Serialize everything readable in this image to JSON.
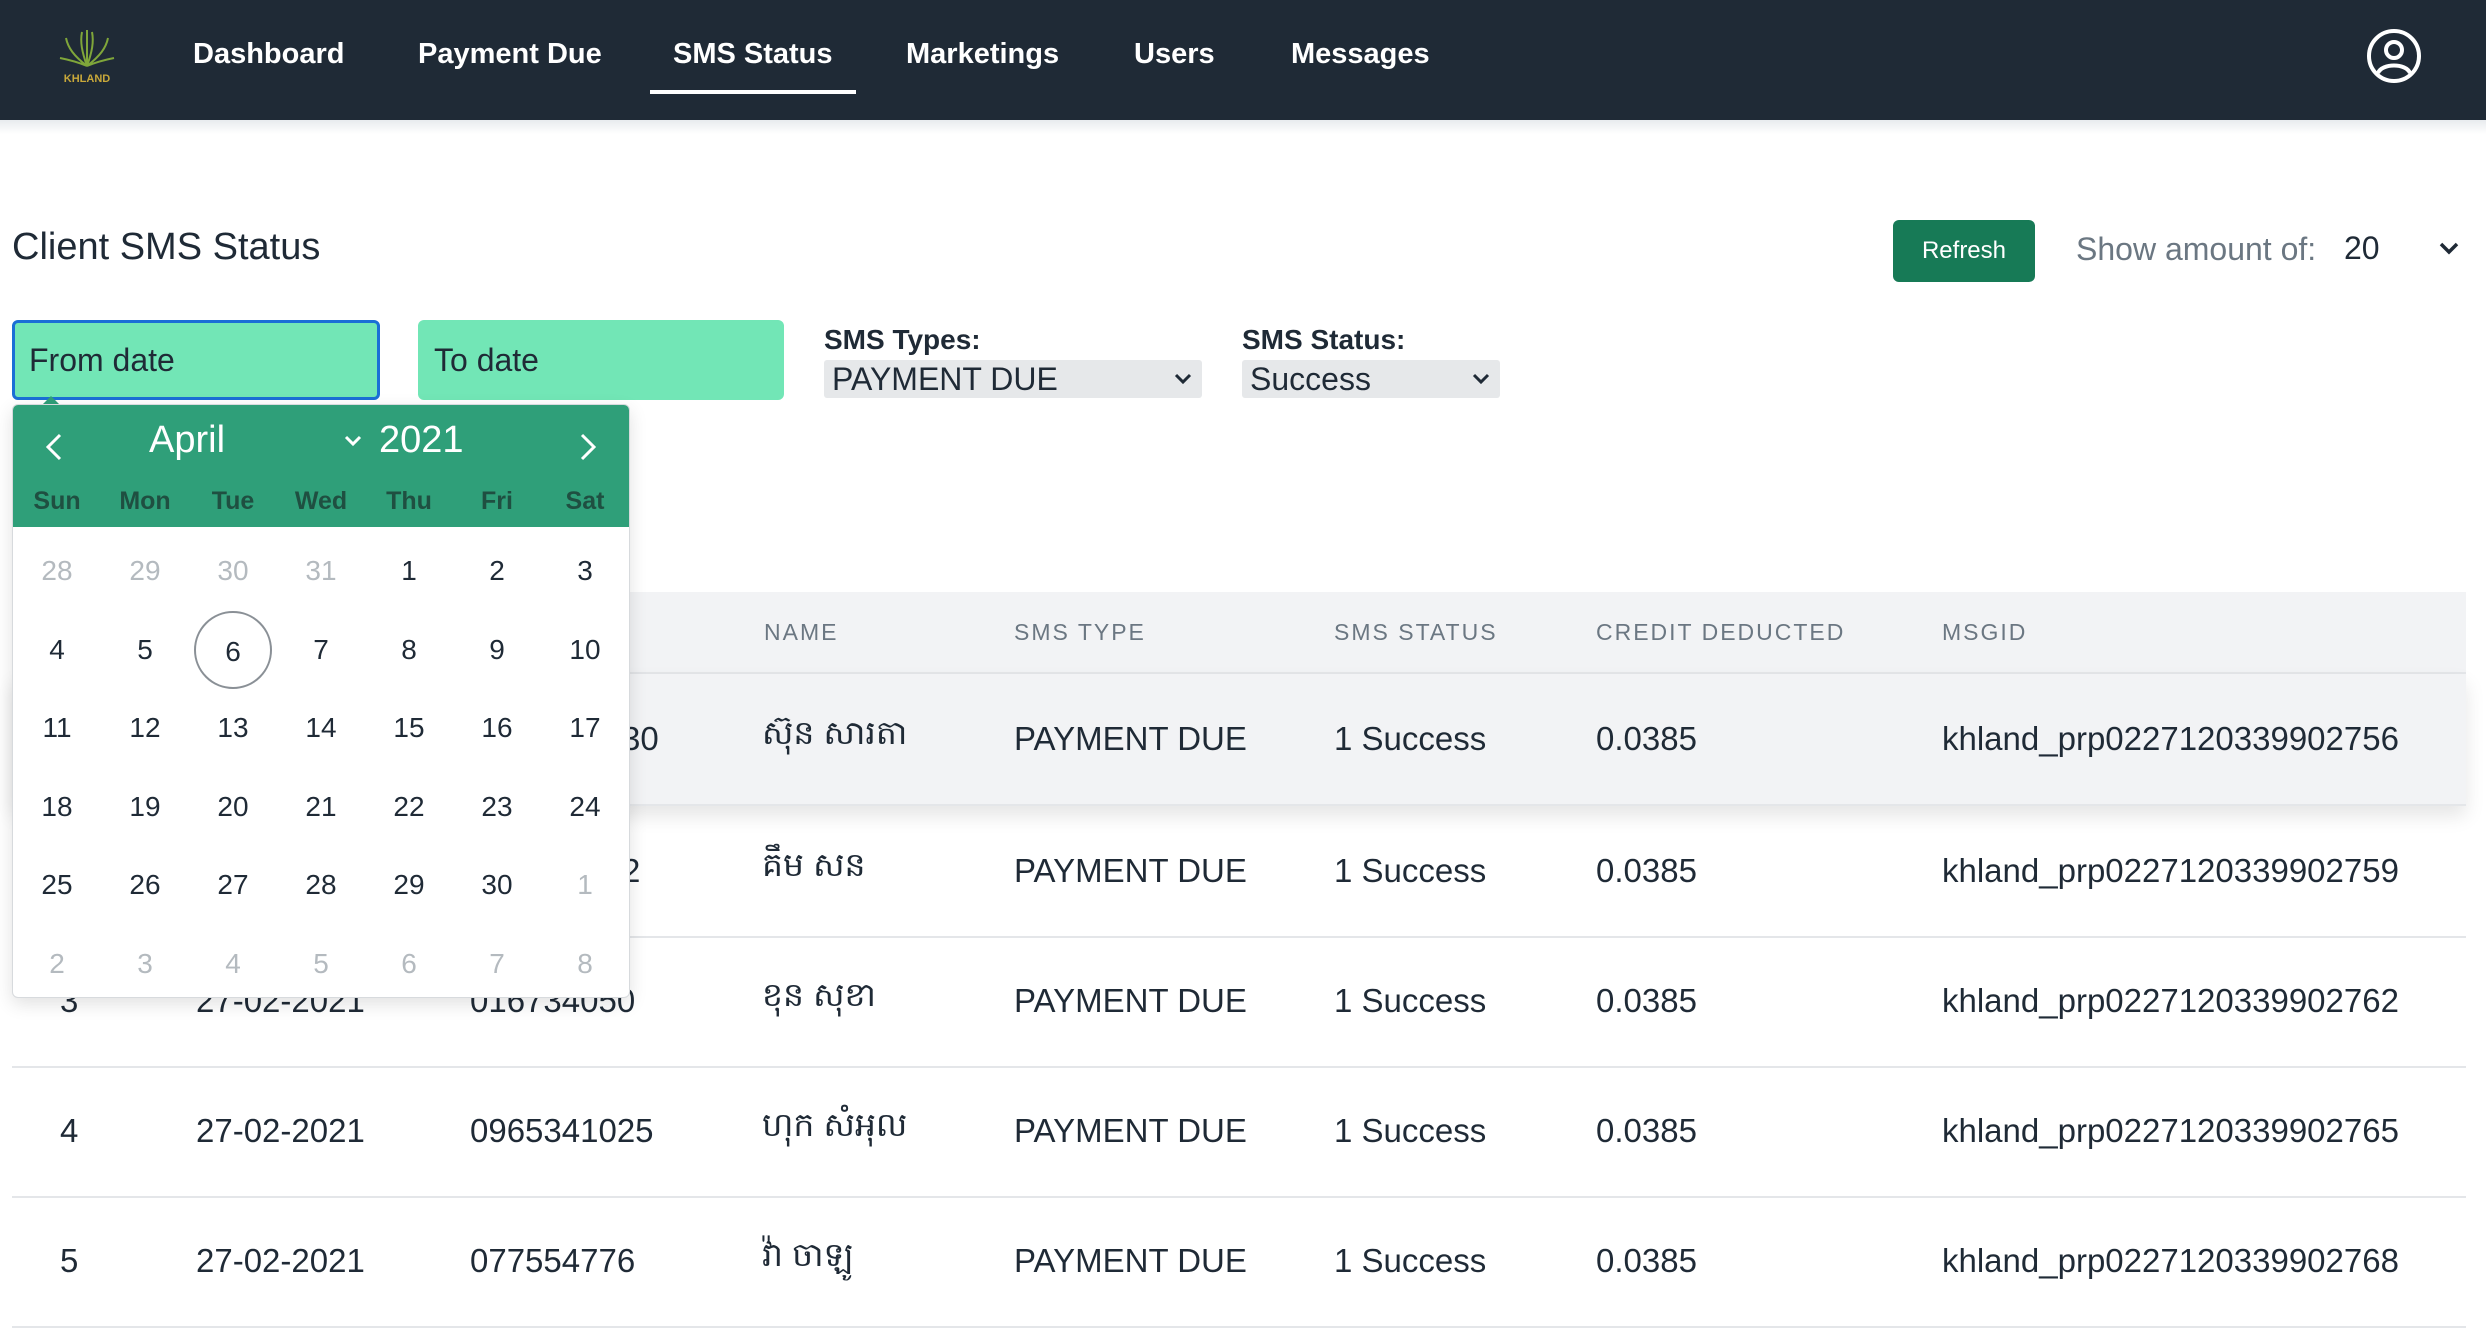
{
  "nav": {
    "logo_text": "KHLAND",
    "items": [
      {
        "label": "Dashboard"
      },
      {
        "label": "Payment Due"
      },
      {
        "label": "SMS Status"
      },
      {
        "label": "Marketings"
      },
      {
        "label": "Users"
      },
      {
        "label": "Messages"
      }
    ],
    "active": "SMS Status",
    "account_icon": "user-circle-icon"
  },
  "page": {
    "title": "Client SMS Status",
    "refresh_label": "Refresh",
    "show_amount_label": "Show amount of:",
    "show_amount_value": "20"
  },
  "filters": {
    "from_date_placeholder": "From date",
    "to_date_placeholder": "To date",
    "sms_types_label": "SMS Types:",
    "sms_types_value": "PAYMENT DUE",
    "sms_status_label": "SMS Status:",
    "sms_status_value": "Success"
  },
  "calendar": {
    "month": "April",
    "year": "2021",
    "weekdays": [
      "Sun",
      "Mon",
      "Tue",
      "Wed",
      "Thu",
      "Fri",
      "Sat"
    ],
    "weeks": [
      [
        {
          "d": "28",
          "m": true
        },
        {
          "d": "29",
          "m": true
        },
        {
          "d": "30",
          "m": true
        },
        {
          "d": "31",
          "m": true
        },
        {
          "d": "1"
        },
        {
          "d": "2"
        },
        {
          "d": "3"
        }
      ],
      [
        {
          "d": "4"
        },
        {
          "d": "5"
        },
        {
          "d": "6",
          "today": true
        },
        {
          "d": "7"
        },
        {
          "d": "8"
        },
        {
          "d": "9"
        },
        {
          "d": "10"
        }
      ],
      [
        {
          "d": "11"
        },
        {
          "d": "12"
        },
        {
          "d": "13"
        },
        {
          "d": "14"
        },
        {
          "d": "15"
        },
        {
          "d": "16"
        },
        {
          "d": "17"
        }
      ],
      [
        {
          "d": "18"
        },
        {
          "d": "19"
        },
        {
          "d": "20"
        },
        {
          "d": "21"
        },
        {
          "d": "22"
        },
        {
          "d": "23"
        },
        {
          "d": "24"
        }
      ],
      [
        {
          "d": "25"
        },
        {
          "d": "26"
        },
        {
          "d": "27"
        },
        {
          "d": "28"
        },
        {
          "d": "29"
        },
        {
          "d": "30"
        },
        {
          "d": "1",
          "m": true
        }
      ],
      [
        {
          "d": "2",
          "m": true
        },
        {
          "d": "3",
          "m": true
        },
        {
          "d": "4",
          "m": true
        },
        {
          "d": "5",
          "m": true
        },
        {
          "d": "6",
          "m": true
        },
        {
          "d": "7",
          "m": true
        },
        {
          "d": "8",
          "m": true
        }
      ]
    ]
  },
  "table": {
    "headers": {
      "name": "NAME",
      "sms_type": "SMS TYPE",
      "sms_status": "SMS STATUS",
      "credit": "CREDIT DEDUCTED",
      "msgid": "MSGID"
    },
    "rows": [
      {
        "no": "",
        "date": "",
        "phone": "30",
        "name": "ស៊ុន សារតា",
        "sms_type": "PAYMENT DUE",
        "sms_status": "1 Success",
        "credit": "0.0385",
        "msgid": "khland_prp0227120339902756"
      },
      {
        "no": "",
        "date": "",
        "phone": "2",
        "name": "គឹម សន",
        "sms_type": "PAYMENT DUE",
        "sms_status": "1 Success",
        "credit": "0.0385",
        "msgid": "khland_prp0227120339902759"
      },
      {
        "no": "3",
        "date": "27-02-2021",
        "phone": "016734050",
        "name": "ខុន សុខា",
        "sms_type": "PAYMENT DUE",
        "sms_status": "1 Success",
        "credit": "0.0385",
        "msgid": "khland_prp0227120339902762"
      },
      {
        "no": "4",
        "date": "27-02-2021",
        "phone": "0965341025",
        "name": "ហុក សំអុល",
        "sms_type": "PAYMENT DUE",
        "sms_status": "1 Success",
        "credit": "0.0385",
        "msgid": "khland_prp0227120339902765"
      },
      {
        "no": "5",
        "date": "27-02-2021",
        "phone": "077554776",
        "name": "វ៉ា ចាឡូ",
        "sms_type": "PAYMENT DUE",
        "sms_status": "1 Success",
        "credit": "0.0385",
        "msgid": "khland_prp0227120339902768"
      }
    ]
  }
}
